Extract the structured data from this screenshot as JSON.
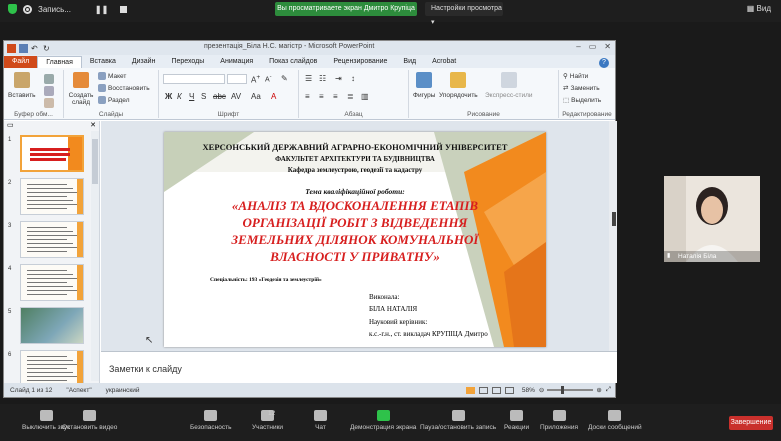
{
  "zoom": {
    "recording_label": "Запись...",
    "share_banner": "Вы просматриваете экран Дмитро Крупіца",
    "view_settings": "Настройки просмотра",
    "view_mode": "Вид",
    "participant_name": "Наталія Біла",
    "end_button": "Завершение",
    "toolbar": [
      {
        "label": "Выключить звук",
        "icon": "mic-icon"
      },
      {
        "label": "Остановить видео",
        "icon": "video-camera-icon"
      },
      {
        "label": "Безопасность",
        "icon": "shield-icon"
      },
      {
        "label": "Участники",
        "icon": "participants-icon",
        "count": "12"
      },
      {
        "label": "Чат",
        "icon": "chat-icon"
      },
      {
        "label": "Демонстрация экрана",
        "icon": "share-screen-icon"
      },
      {
        "label": "Пауза/остановить запись",
        "icon": "pause-record-icon"
      },
      {
        "label": "Реакции",
        "icon": "smile-icon"
      },
      {
        "label": "Приложения",
        "icon": "apps-icon"
      },
      {
        "label": "Доски сообщений",
        "icon": "whiteboard-icon"
      }
    ]
  },
  "ppt": {
    "window_title": "презентація_Біла Н.С. магістр  -  Microsoft PowerPoint",
    "tabs": [
      "Файл",
      "Главная",
      "Вставка",
      "Дизайн",
      "Переходы",
      "Анимация",
      "Показ слайдов",
      "Рецензирование",
      "Вид",
      "Acrobat"
    ],
    "active_tab": "Главная",
    "ribbon": {
      "paste": "Вставить",
      "clipboard_group": "Буфер обм...",
      "new_slide": "Создать слайд",
      "layout": "Макет",
      "reset": "Восстановить",
      "section": "Раздел",
      "slides_group": "Слайды",
      "font_group": "Шрифт",
      "paragraph_group": "Абзац",
      "shapes": "Фигуры",
      "arrange": "Упорядочить",
      "quick_styles": "Экспресс-стили",
      "drawing_group": "Рисование",
      "find": "Найти",
      "replace": "Заменить",
      "select": "Выделить",
      "editing_group": "Редактирование"
    },
    "slide": {
      "university": "ХЕРСОНСЬКИЙ ДЕРЖАВНИЙ АГРАРНО-ЕКОНОМІЧНИЙ УНІВЕРСИТЕТ",
      "faculty": "ФАКУЛЬТЕТ АРХІТЕКТУРИ ТА БУДІВНИЦТВА",
      "department": "Кафедра землеустрою, геодезії та кадастру",
      "theme_label": "Тема кваліфікаційної роботи:",
      "title_lines": [
        "«АНАЛІЗ ТА ВДОСКОНАЛЕННЯ ЕТАПІВ",
        "ОРГАНІЗАЦІЇ РОБІТ З ВІДВЕДЕННЯ",
        "ЗЕМЕЛЬНИХ ДІЛЯНОК КОМУНАЛЬНОЇ",
        "ВЛАСНОСТІ У ПРИВАТНУ»"
      ],
      "specialty": "Спеціальність: 193 «Геодезія та землеустрій»",
      "performed_label": "Виконала:",
      "author": "БІЛА НАТАЛІЯ",
      "supervisor_label": "Науковий керівник:",
      "supervisor": "к.с.-г.н., ст. викладач КРУПІЦА Дмитро"
    },
    "notes_placeholder": "Заметки к слайду",
    "status": {
      "slide_info": "Слайд 1 из 12",
      "theme": "\"Аспект\"",
      "language": "украинский",
      "zoom": "58%"
    },
    "thumbnail_numbers": [
      "1",
      "2",
      "3",
      "4",
      "5",
      "6"
    ]
  },
  "colors": {
    "accent_orange": "#f28a1e",
    "title_red": "#d71f1f",
    "zoom_green": "#2d8c3c",
    "end_red": "#c9302c"
  }
}
